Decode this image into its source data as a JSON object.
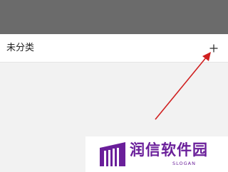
{
  "group": {
    "label": "未分类",
    "add_icon": "plus-icon"
  },
  "annotation": {
    "icon": "red-arrow",
    "color": "#d02020"
  },
  "watermark": {
    "brand": "润信软件园",
    "slogan": "SLOGAN",
    "color": "#6a1f9a"
  }
}
